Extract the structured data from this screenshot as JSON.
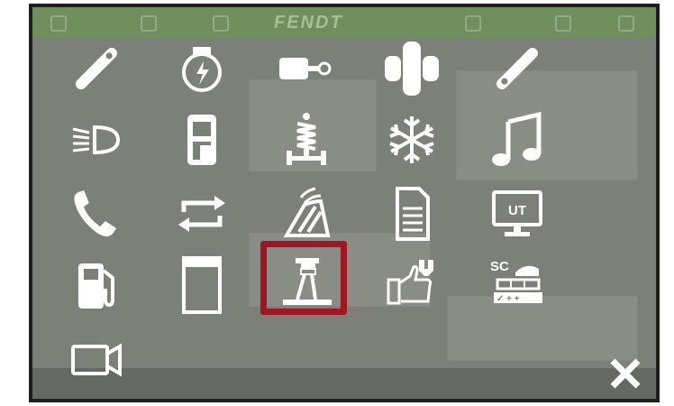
{
  "header": {
    "brand": "FENDT"
  },
  "menu_items": [
    {
      "icon": "key-icon"
    },
    {
      "icon": "engine-icon"
    },
    {
      "icon": "hitch-icon"
    },
    {
      "icon": "axle-icon"
    },
    {
      "icon": "key-alt-icon"
    },
    {
      "icon": "headlight-icon"
    },
    {
      "icon": "cab-door-icon"
    },
    {
      "icon": "suspension-icon"
    },
    {
      "icon": "snowflake-icon"
    },
    {
      "icon": "music-icon"
    },
    {
      "icon": "phone-icon"
    },
    {
      "icon": "repeat-icon"
    },
    {
      "icon": "wiper-icon"
    },
    {
      "icon": "document-icon"
    },
    {
      "icon": "ut-monitor-icon",
      "label": "UT"
    },
    {
      "icon": "fuel-pump-icon"
    },
    {
      "icon": "panel-icon"
    },
    {
      "icon": "lift-icon",
      "selected": true
    },
    {
      "icon": "service-hand-icon"
    },
    {
      "icon": "sc-sectioncontrol-icon",
      "label": "SC"
    },
    {
      "icon": "camera-icon"
    }
  ],
  "colors": {
    "selection": "#a01622",
    "overlay": "#7d7f79",
    "topbar": "#6f8f5c",
    "icon": "#ffffff"
  }
}
